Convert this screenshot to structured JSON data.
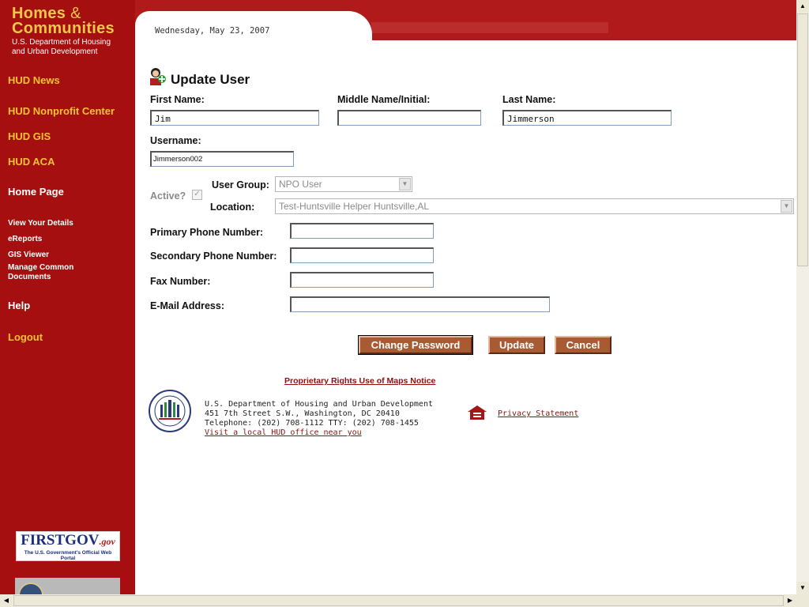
{
  "header": {
    "logo_line1": "Homes",
    "logo_amp": "&",
    "logo_line2": "Communities",
    "logo_sub1": "U.S. Department of Housing",
    "logo_sub2": "and Urban Development",
    "date": "Wednesday, May 23, 2007"
  },
  "sidebar": {
    "primary": [
      "HUD News",
      "HUD Nonprofit Center",
      "HUD GIS",
      "HUD ACA"
    ],
    "home": "Home Page",
    "sub": [
      "View Your Details",
      "eReports",
      "GIS Viewer",
      "Manage Common",
      "Documents"
    ],
    "help": "Help",
    "logout": "Logout",
    "firstgov": {
      "name": "FIRSTGOV",
      "gov": ".gov",
      "tagline": "The U.S. Government's Official Web Portal"
    }
  },
  "form": {
    "title": "Update User",
    "first_name_label": "First Name:",
    "first_name_value": "Jim",
    "middle_name_label": "Middle Name/Initial:",
    "middle_name_value": "",
    "last_name_label": "Last Name:",
    "last_name_value": "Jimmerson",
    "username_label": "Username:",
    "username_value": "Jimmerson002",
    "active_label": "Active?",
    "active_checked": true,
    "user_group_label": "User Group:",
    "user_group_value": "NPO User",
    "location_label": "Location:",
    "location_value": "Test-Huntsville Helper Huntsville,AL",
    "primary_phone_label": "Primary Phone Number:",
    "secondary_phone_label": "Secondary Phone Number:",
    "fax_label": "Fax Number:",
    "email_label": "E-Mail Address:"
  },
  "buttons": {
    "change_password": "Change Password",
    "update": "Update",
    "cancel": "Cancel"
  },
  "footer": {
    "notice": "Proprietary Rights Use of Maps Notice",
    "addr1": "U.S. Department of Housing and Urban Development",
    "addr2": "451 7th Street S.W., Washington, DC 20410",
    "addr3": "Telephone: (202) 708-1112  TTY: (202) 708-1455",
    "local_office": "Visit a local HUD office near you",
    "privacy": "Privacy Statement"
  },
  "colors": {
    "sidebar": "#a50f0f",
    "accent_gold": "#f5c233",
    "button": "#a85a32",
    "link": "#8b1010"
  }
}
